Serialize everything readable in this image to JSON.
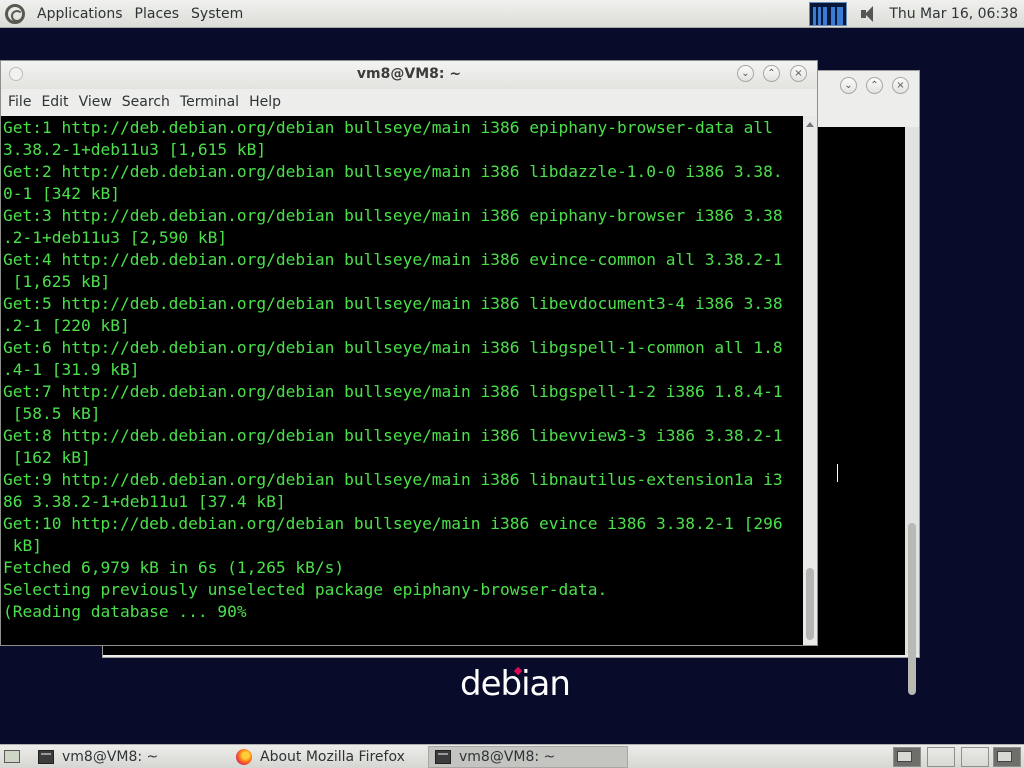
{
  "top_panel": {
    "menus": [
      "Applications",
      "Places",
      "System"
    ],
    "clock": "Thu Mar 16, 06:38",
    "icons": [
      "debian-menu-icon",
      "system-monitor-icon",
      "volume-icon"
    ]
  },
  "terminal_window": {
    "title": "vm8@VM8: ~",
    "menu": [
      "File",
      "Edit",
      "View",
      "Search",
      "Terminal",
      "Help"
    ],
    "colors": {
      "background": "#000000",
      "text": "#4be04b"
    },
    "lines": [
      "Get:1 http://deb.debian.org/debian bullseye/main i386 epiphany-browser-data all",
      "3.38.2-1+deb11u3 [1,615 kB]",
      "Get:2 http://deb.debian.org/debian bullseye/main i386 libdazzle-1.0-0 i386 3.38.",
      "0-1 [342 kB]",
      "Get:3 http://deb.debian.org/debian bullseye/main i386 epiphany-browser i386 3.38",
      ".2-1+deb11u3 [2,590 kB]",
      "Get:4 http://deb.debian.org/debian bullseye/main i386 evince-common all 3.38.2-1",
      " [1,625 kB]",
      "Get:5 http://deb.debian.org/debian bullseye/main i386 libevdocument3-4 i386 3.38",
      ".2-1 [220 kB]",
      "Get:6 http://deb.debian.org/debian bullseye/main i386 libgspell-1-common all 1.8",
      ".4-1 [31.9 kB]",
      "Get:7 http://deb.debian.org/debian bullseye/main i386 libgspell-1-2 i386 1.8.4-1",
      " [58.5 kB]",
      "Get:8 http://deb.debian.org/debian bullseye/main i386 libevview3-3 i386 3.38.2-1",
      " [162 kB]",
      "Get:9 http://deb.debian.org/debian bullseye/main i386 libnautilus-extension1a i3",
      "86 3.38.2-1+deb11u1 [37.4 kB]",
      "Get:10 http://deb.debian.org/debian bullseye/main i386 evince i386 3.38.2-1 [296",
      " kB]",
      "Fetched 6,979 kB in 6s (1,265 kB/s)",
      "Selecting previously unselected package epiphany-browser-data.",
      "(Reading database ... 90%"
    ]
  },
  "desktop": {
    "logo_text": "debian",
    "background": "#080c2a"
  },
  "bottom_panel": {
    "tasks": [
      {
        "label": "vm8@VM8: ~",
        "icon": "terminal-icon",
        "active": false
      },
      {
        "label": "About Mozilla Firefox",
        "icon": "firefox-icon",
        "active": false
      },
      {
        "label": "vm8@VM8: ~",
        "icon": "terminal-icon",
        "active": true
      }
    ]
  }
}
